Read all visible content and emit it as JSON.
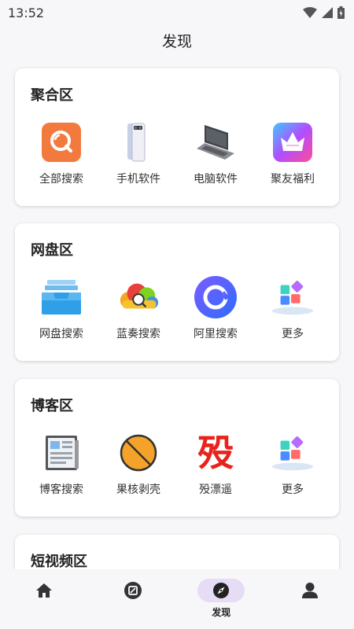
{
  "status_bar": {
    "time": "13:52"
  },
  "header": {
    "title": "发现"
  },
  "sections": [
    {
      "title": "聚合区",
      "items": [
        {
          "label": "全部搜索",
          "icon": "search-app-icon"
        },
        {
          "label": "手机软件",
          "icon": "phone-icon"
        },
        {
          "label": "电脑软件",
          "icon": "laptop-icon"
        },
        {
          "label": "聚友福利",
          "icon": "crown-icon"
        }
      ]
    },
    {
      "title": "网盘区",
      "items": [
        {
          "label": "网盘搜索",
          "icon": "inbox-tray-icon"
        },
        {
          "label": "蓝奏搜索",
          "icon": "cloud-search-icon"
        },
        {
          "label": "阿里搜索",
          "icon": "aliyun-drive-icon"
        },
        {
          "label": "更多",
          "icon": "more-blocks-icon"
        }
      ]
    },
    {
      "title": "博客区",
      "items": [
        {
          "label": "博客搜索",
          "icon": "newspaper-icon"
        },
        {
          "label": "果核剥壳",
          "icon": "nut-icon"
        },
        {
          "label": "殁漂遥",
          "icon": "mo-character-icon"
        },
        {
          "label": "更多",
          "icon": "more-blocks-icon"
        }
      ]
    },
    {
      "title": "短视频区"
    }
  ],
  "mo_glyph": "殁",
  "bottom_nav": {
    "active_label": "发现",
    "items": [
      {
        "icon": "home-icon"
      },
      {
        "icon": "app-box-icon"
      },
      {
        "icon": "compass-icon",
        "label": "发现"
      },
      {
        "icon": "person-icon"
      }
    ]
  },
  "colors": {
    "accent_pill": "#e6dcf6",
    "search_orange": "#f27a3f",
    "mo_red": "#e8231b"
  }
}
